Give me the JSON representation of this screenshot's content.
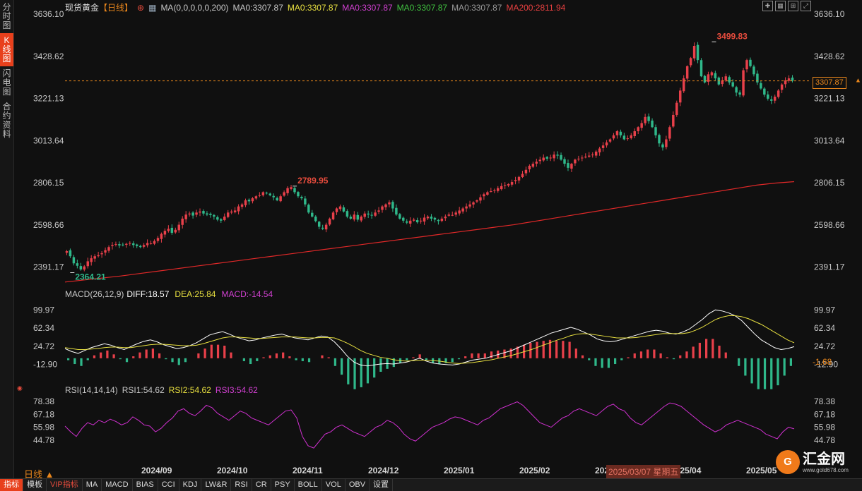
{
  "header": {
    "instrument": "现货黄金",
    "period_tag": "【日线】",
    "ma_config": "MA(0,0,0,0,0,200)",
    "ma_items": [
      {
        "text": "MA0:3307.87",
        "color": "#c8c8c8"
      },
      {
        "text": "MA0:3307.87",
        "color": "#e8e040"
      },
      {
        "text": "MA0:3307.87",
        "color": "#d040d0"
      },
      {
        "text": "MA0:3307.87",
        "color": "#40c040"
      },
      {
        "text": "MA0:3307.87",
        "color": "#999999"
      },
      {
        "text": "MA200:2811.94",
        "color": "#e84040"
      }
    ]
  },
  "sidebar": {
    "tabs": [
      {
        "chars": [
          "分",
          "时",
          "图"
        ],
        "active": false
      },
      {
        "chars": [
          "K",
          "线",
          "图"
        ],
        "active": true
      },
      {
        "chars": [
          "闪",
          "电",
          "图"
        ],
        "active": false
      },
      {
        "chars": [
          "合",
          "约",
          "资",
          "料"
        ],
        "active": false
      }
    ]
  },
  "macd_header": {
    "title": "MACD(26,12,9)",
    "diff": "DIFF:18.57",
    "dea": "DEA:25.84",
    "macd": "MACD:-14.54"
  },
  "rsi_header": {
    "title": "RSI(14,14,14)",
    "rsi1": "RSI1:54.62",
    "rsi2": "RSI2:54.62",
    "rsi3": "RSI3:54.62"
  },
  "price_box": "3307.87",
  "macd_box": "-1.68",
  "period_label": "日线 ▲",
  "crosshair_date": "2025/03/07  星期五",
  "bottom_tabs": [
    {
      "label": "指标",
      "active": true
    },
    {
      "label": "模板"
    },
    {
      "label": "VIP指标",
      "vip": true
    },
    {
      "label": "MA"
    },
    {
      "label": "MACD"
    },
    {
      "label": "BIAS"
    },
    {
      "label": "CCI"
    },
    {
      "label": "KDJ"
    },
    {
      "label": "LW&R"
    },
    {
      "label": "RSI"
    },
    {
      "label": "CR"
    },
    {
      "label": "PSY"
    },
    {
      "label": "BOLL"
    },
    {
      "label": "VOL"
    },
    {
      "label": "OBV"
    },
    {
      "label": "设置"
    }
  ],
  "logo": {
    "mark": "G",
    "name": "汇金网",
    "url": "www.gold678.com"
  },
  "colors": {
    "up": "#e8404a",
    "down": "#2fb88a",
    "ma200": "#e02828",
    "diff": "#ffffff",
    "dea": "#e8e040",
    "rsi": "#d030d0",
    "last": "#e8861c"
  },
  "chart_data": [
    {
      "type": "candlestick",
      "title": "现货黄金【日线】",
      "price_ticks": [
        "3636.10",
        "3428.62",
        "3221.13",
        "3013.64",
        "2806.15",
        "2598.66",
        "2391.17"
      ],
      "ylim": [
        2300,
        3636.1
      ],
      "x_labels": [
        "2024/09",
        "2024/10",
        "2024/11",
        "2024/12",
        "2025/01",
        "2025/02",
        "2025/03",
        "2025/04",
        "2025/05"
      ],
      "annotations": [
        {
          "text": "3499.83",
          "value": 3499.83,
          "near": "2025/04"
        },
        {
          "text": "2789.95",
          "value": 2789.95,
          "near": "2024/10"
        },
        {
          "text": "2364.21",
          "value": 2364.21,
          "near": "2024/08"
        }
      ],
      "last_price": 3307.87,
      "closes": [
        2470,
        2445,
        2410,
        2398,
        2380,
        2395,
        2420,
        2435,
        2445,
        2450,
        2460,
        2475,
        2490,
        2500,
        2505,
        2498,
        2502,
        2506,
        2510,
        2500,
        2495,
        2490,
        2500,
        2510,
        2508,
        2520,
        2535,
        2555,
        2570,
        2580,
        2560,
        2575,
        2600,
        2630,
        2650,
        2655,
        2645,
        2660,
        2665,
        2655,
        2650,
        2648,
        2640,
        2625,
        2620,
        2640,
        2660,
        2665,
        2670,
        2690,
        2700,
        2720,
        2715,
        2730,
        2740,
        2745,
        2760,
        2755,
        2745,
        2735,
        2720,
        2740,
        2760,
        2780,
        2785,
        2760,
        2740,
        2730,
        2700,
        2660,
        2640,
        2618,
        2590,
        2580,
        2600,
        2630,
        2660,
        2680,
        2690,
        2665,
        2640,
        2630,
        2650,
        2625,
        2640,
        2655,
        2650,
        2645,
        2660,
        2670,
        2690,
        2700,
        2710,
        2680,
        2650,
        2630,
        2620,
        2610,
        2620,
        2625,
        2612,
        2620,
        2635,
        2640,
        2630,
        2625,
        2618,
        2630,
        2640,
        2650,
        2648,
        2660,
        2670,
        2680,
        2690,
        2700,
        2710,
        2720,
        2735,
        2750,
        2760,
        2765,
        2770,
        2780,
        2790,
        2795,
        2800,
        2810,
        2820,
        2835,
        2850,
        2870,
        2890,
        2900,
        2910,
        2920,
        2930,
        2925,
        2930,
        2945,
        2940,
        2920,
        2900,
        2880,
        2900,
        2920,
        2925,
        2930,
        2935,
        2940,
        2945,
        2960,
        2975,
        2990,
        3005,
        3020,
        3040,
        3060,
        3040,
        3020,
        3025,
        3040,
        3060,
        3080,
        3100,
        3130,
        3110,
        3080,
        3040,
        3000,
        2980,
        3020,
        3080,
        3140,
        3200,
        3260,
        3320,
        3380,
        3420,
        3480,
        3410,
        3330,
        3300,
        3340,
        3350,
        3320,
        3290,
        3310,
        3330,
        3300,
        3280,
        3250,
        3240,
        3360,
        3410,
        3380,
        3340,
        3300,
        3270,
        3240,
        3220,
        3210,
        3230,
        3260,
        3290,
        3310,
        3320,
        3307.87
      ],
      "ma200": [
        2318,
        2328,
        2338,
        2348,
        2360,
        2372,
        2384,
        2396,
        2408,
        2420,
        2432,
        2444,
        2456,
        2468,
        2480,
        2492,
        2504,
        2516,
        2528,
        2540,
        2552,
        2564,
        2576,
        2588,
        2600,
        2615,
        2630,
        2645,
        2660,
        2675,
        2690,
        2705,
        2720,
        2735,
        2750,
        2765,
        2780,
        2795,
        2805,
        2811.94
      ],
      "series": [
        {
          "name": "MA200",
          "values_ref": "ma200"
        }
      ]
    },
    {
      "type": "line+bar",
      "title": "MACD(26,12,9)",
      "y_ticks": [
        "99.97",
        "62.34",
        "24.72",
        "-12.90"
      ],
      "ylim": [
        -47,
        118
      ],
      "series": [
        {
          "name": "DIFF",
          "values": [
            20,
            14,
            10,
            16,
            22,
            26,
            30,
            27,
            22,
            18,
            24,
            30,
            35,
            38,
            34,
            28,
            24,
            20,
            22,
            26,
            32,
            40,
            48,
            52,
            55,
            50,
            44,
            40,
            36,
            38,
            42,
            45,
            48,
            50,
            46,
            42,
            40,
            38,
            42,
            46,
            44,
            34,
            20,
            4,
            -8,
            -14,
            -16,
            -14,
            -12,
            -11,
            -12,
            -10,
            -8,
            -4,
            0,
            -6,
            -10,
            -12,
            -13,
            -14,
            -12,
            -8,
            -4,
            -2,
            0,
            4,
            8,
            12,
            16,
            22,
            28,
            34,
            40,
            46,
            52,
            56,
            60,
            64,
            60,
            54,
            48,
            40,
            36,
            34,
            36,
            40,
            44,
            48,
            52,
            56,
            58,
            56,
            52,
            50,
            54,
            60,
            70,
            80,
            92,
            100,
            98,
            94,
            88,
            78,
            64,
            50,
            38,
            30,
            22,
            18,
            20,
            24
          ]
        },
        {
          "name": "DEA",
          "values": [
            22,
            20,
            18,
            18,
            19,
            20,
            22,
            23,
            23,
            22,
            22,
            24,
            26,
            28,
            29,
            29,
            28,
            27,
            26,
            26,
            27,
            30,
            34,
            38,
            42,
            44,
            44,
            43,
            42,
            41,
            41,
            42,
            43,
            44,
            44,
            44,
            43,
            42,
            42,
            43,
            43,
            42,
            37,
            31,
            24,
            16,
            10,
            6,
            2,
            0,
            -3,
            -5,
            -6,
            -5,
            -4,
            -4,
            -5,
            -6,
            -8,
            -10,
            -11,
            -10,
            -9,
            -7,
            -5,
            -3,
            0,
            3,
            6,
            10,
            14,
            18,
            23,
            28,
            33,
            38,
            42,
            47,
            50,
            51,
            50,
            48,
            46,
            44,
            42,
            42,
            42,
            43,
            45,
            47,
            49,
            51,
            51,
            51,
            51,
            53,
            58,
            64,
            72,
            80,
            85,
            88,
            88,
            86,
            82,
            76,
            70,
            62,
            54,
            46,
            38,
            32
          ]
        },
        {
          "name": "MACD",
          "values": [
            -4,
            -12,
            -16,
            -4,
            6,
            12,
            16,
            8,
            -2,
            -8,
            4,
            12,
            18,
            20,
            10,
            -2,
            -8,
            -14,
            -8,
            0,
            10,
            20,
            28,
            28,
            26,
            12,
            0,
            -6,
            -12,
            -6,
            2,
            6,
            10,
            12,
            4,
            -4,
            -6,
            -8,
            0,
            6,
            2,
            -16,
            -34,
            -54,
            -64,
            -60,
            -52,
            -40,
            -28,
            -22,
            -18,
            -10,
            -4,
            2,
            8,
            -4,
            -10,
            -12,
            -10,
            -8,
            -2,
            4,
            10,
            10,
            10,
            14,
            16,
            18,
            20,
            24,
            28,
            32,
            34,
            36,
            38,
            36,
            36,
            34,
            20,
            6,
            -4,
            -16,
            -20,
            -20,
            -12,
            -4,
            2,
            10,
            14,
            18,
            18,
            10,
            2,
            -2,
            6,
            14,
            24,
            32,
            40,
            40,
            26,
            12,
            0,
            -16,
            -36,
            -52,
            -64,
            -64,
            -64,
            -56,
            -36,
            -16
          ]
        }
      ]
    },
    {
      "type": "line",
      "title": "RSI(14,14,14)",
      "y_ticks": [
        "78.38",
        "67.18",
        "55.98",
        "44.78"
      ],
      "ylim": [
        35,
        82
      ],
      "series": [
        {
          "name": "RSI1",
          "values": [
            57,
            52,
            48,
            55,
            60,
            58,
            62,
            60,
            63,
            61,
            58,
            60,
            65,
            62,
            58,
            57,
            52,
            55,
            60,
            64,
            70,
            72,
            68,
            66,
            70,
            75,
            73,
            68,
            65,
            62,
            66,
            70,
            68,
            64,
            62,
            60,
            58,
            62,
            66,
            70,
            71,
            64,
            48,
            40,
            38,
            44,
            50,
            52,
            56,
            58,
            55,
            52,
            50,
            48,
            52,
            56,
            58,
            62,
            60,
            56,
            50,
            46,
            44,
            48,
            52,
            56,
            58,
            60,
            63,
            65,
            64,
            62,
            60,
            58,
            62,
            64,
            68,
            72,
            74,
            76,
            78,
            75,
            70,
            65,
            60,
            58,
            56,
            60,
            64,
            66,
            70,
            72,
            70,
            68,
            66,
            70,
            74,
            76,
            72,
            70,
            64,
            60,
            58,
            62,
            66,
            70,
            74,
            77,
            76,
            74,
            70,
            66,
            62,
            58,
            55,
            52,
            54,
            58,
            60,
            62,
            60,
            58,
            56,
            54,
            50,
            48,
            46,
            52,
            56,
            54.62
          ]
        }
      ]
    }
  ]
}
